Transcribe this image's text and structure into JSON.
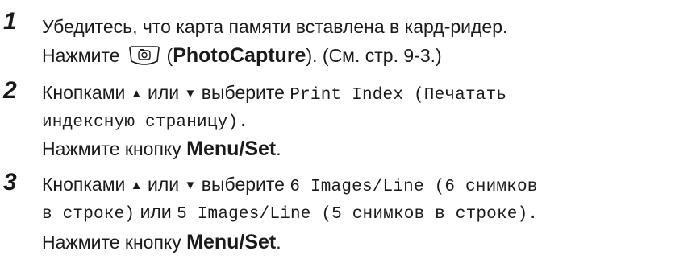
{
  "steps": [
    {
      "number": "1",
      "line1": "Убедитесь, что карта памяти вставлена в кард-ридер.",
      "line2_prefix": "Нажмите",
      "key_icon": "photocapture-key-icon",
      "line2_paren_open": "(",
      "line2_bold": "PhotoCapture",
      "line2_suffix": "). (См. стр. 9-3.)"
    },
    {
      "number": "2",
      "l1_pre": "Кнопками",
      "up_glyph": "▲",
      "or_word": "или",
      "down_glyph": "▼",
      "choose_word": "выберите",
      "mono1": "Print Index (Печатать",
      "mono2": "индексную страницу).",
      "press_prefix": "Нажмите кнопку",
      "press_bold": "Menu/Set",
      "press_suffix": "."
    },
    {
      "number": "3",
      "l1_pre": "Кнопками",
      "up_glyph": "▲",
      "or_word": "или",
      "down_glyph": "▼",
      "choose_word": "выберите",
      "mono1": "6 Images/Line (6 снимков",
      "mono2a": "в строке)",
      "or_word2": "или",
      "mono2b": "5 Images/Line (5 снимков в строке).",
      "press_prefix": "Нажмите кнопку",
      "press_bold": "Menu/Set",
      "press_suffix": "."
    }
  ]
}
